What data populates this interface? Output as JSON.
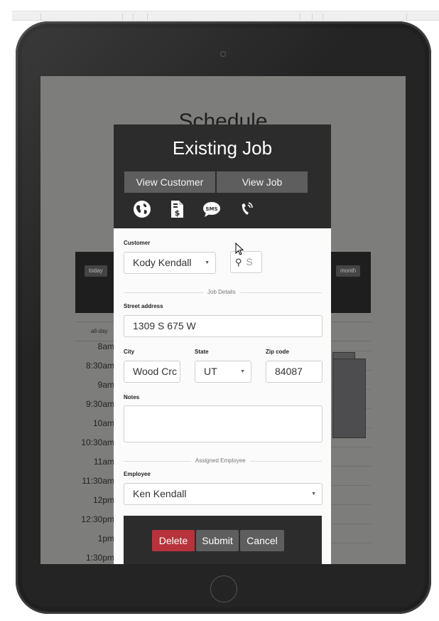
{
  "background_page": {
    "title": "Schedule",
    "calendar": {
      "today_button": "today",
      "month_button": "month",
      "allday_label": "all-day",
      "times": [
        "8am",
        "8:30am",
        "9am",
        "9:30am",
        "10am",
        "10:30am",
        "11am",
        "11:30am",
        "12pm",
        "12:30pm",
        "1pm",
        "1:30pm"
      ]
    }
  },
  "modal": {
    "title": "Existing Job",
    "view_customer_button": "View Customer",
    "view_job_button": "View Job",
    "icons": [
      "globe-icon",
      "invoice-icon",
      "sms-icon",
      "phone-call-icon"
    ],
    "customer": {
      "label": "Customer",
      "selected": "Kody Kendall",
      "search_placeholder": "S"
    },
    "job_details_divider": "Job Details",
    "street_address": {
      "label": "Street address",
      "value": "1309 S 675 W"
    },
    "city": {
      "label": "City",
      "value": "Wood Crc"
    },
    "state": {
      "label": "State",
      "value": "UT"
    },
    "zip": {
      "label": "Zip code",
      "value": "84087"
    },
    "notes": {
      "label": "Notes",
      "value": ""
    },
    "assigned_employee_divider": "Assigned Employee",
    "employee": {
      "label": "Employee",
      "selected": "Ken Kendall"
    },
    "buttons": {
      "delete": "Delete",
      "submit": "Submit",
      "cancel": "Cancel"
    }
  },
  "colors": {
    "header_dark": "#2c2c2c",
    "button_gray": "#5e5e5e",
    "delete_red": "#b8323c"
  }
}
